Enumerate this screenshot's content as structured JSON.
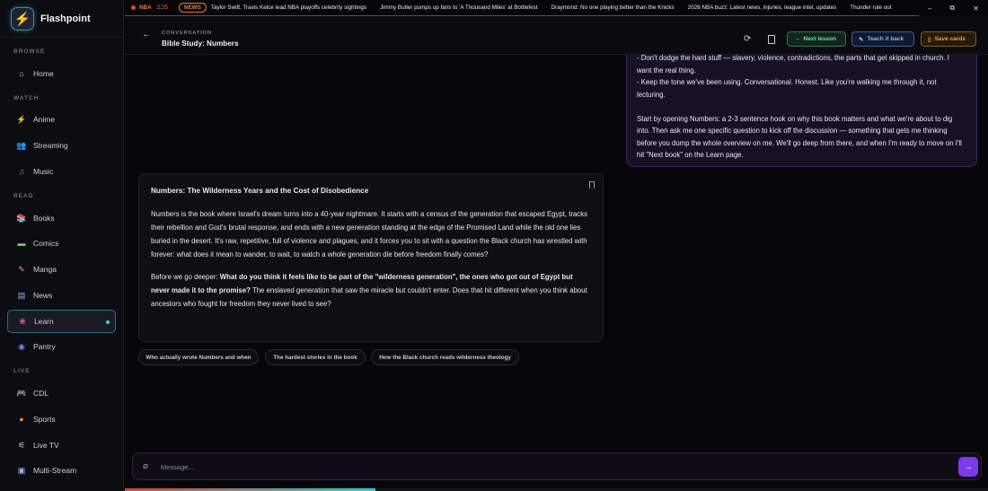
{
  "brand": {
    "name": "Flashpoint",
    "logo_icon": "⚡"
  },
  "sidebar": {
    "sections": [
      {
        "label": "BROWSE",
        "items": [
          {
            "label": "Home",
            "icon": "home-icon",
            "glyph": "⌂",
            "color": "#ccccd4"
          }
        ]
      },
      {
        "label": "WATCH",
        "items": [
          {
            "label": "Anime",
            "icon": "lightning-icon",
            "glyph": "⚡",
            "color": "#f07a2a"
          },
          {
            "label": "Streaming",
            "icon": "people-icon",
            "glyph": "👥",
            "color": "#a57af5"
          },
          {
            "label": "Music",
            "icon": "music-note-icon",
            "glyph": "♫",
            "color": "#e6508a"
          }
        ]
      },
      {
        "label": "READ",
        "items": [
          {
            "label": "Books",
            "icon": "books-icon",
            "glyph": "📚",
            "color": "#3cc46a"
          },
          {
            "label": "Comics",
            "icon": "comic-icon",
            "glyph": "▬",
            "color": "#63d44d"
          },
          {
            "label": "Manga",
            "icon": "manga-icon",
            "glyph": "✎",
            "color": "#e8a246"
          },
          {
            "label": "News",
            "icon": "newspaper-icon",
            "glyph": "▤",
            "color": "#8fb4ef"
          },
          {
            "label": "Learn",
            "icon": "brain-icon",
            "glyph": "❀",
            "color": "#e066b0",
            "active": true
          },
          {
            "label": "Pantry",
            "icon": "pantry-icon",
            "glyph": "◉",
            "color": "#8b7cf3"
          }
        ]
      },
      {
        "label": "LIVE",
        "items": [
          {
            "label": "CDL",
            "icon": "gamepad-icon",
            "glyph": "🎮",
            "color": "#a88cf2"
          },
          {
            "label": "Sports",
            "icon": "basketball-icon",
            "glyph": "●",
            "color": "#ef7d2c"
          },
          {
            "label": "Live TV",
            "icon": "antenna-icon",
            "glyph": "⚟",
            "color": "#d6d6de"
          },
          {
            "label": "Multi-Stream",
            "icon": "monitor-icon",
            "glyph": "▣",
            "color": "#9fb7e6"
          }
        ]
      }
    ]
  },
  "ticker": {
    "league": "NBA",
    "clock": "2:25",
    "news_badge": "NEWS",
    "headlines": [
      "Taylor Swift, Travis Kelce lead NBA playoffs celebrity sightings",
      "Jimmy Butler pumps up fans to 'A Thousand Miles' at Bottlefest",
      "Draymond: No one playing better than the Knicks",
      "2026 NBA buzz: Latest news, injuries, league intel, updates",
      "Thunder rule out"
    ]
  },
  "window_controls": {
    "minimize": "–",
    "maximize": "⧉",
    "close": "✕"
  },
  "header": {
    "label": "CONVERSATION",
    "title": "Bible Study: Numbers",
    "next": "Next lesson",
    "teach": "Teach it back",
    "save": "Save cards"
  },
  "chat": {
    "user": {
      "lines": [
        "- Don't dodge the hard stuff — slavery, violence, contradictions, the parts that get skipped in church. I want the real thing.",
        "- Keep the tone we've been using. Conversational. Honest. Like you're walking me through it, not lecturing."
      ],
      "closing": "Start by opening Numbers: a 2-3 sentence hook on why this book matters and what we're about to dig into. Then ask me one specific question to kick off the discussion — something that gets me thinking before you dump the whole overview on me. We'll go deep from there, and when I'm ready to move on I'll hit \"Next book\" on the Learn page."
    },
    "assistant": {
      "title": "Numbers: The Wilderness Years and the Cost of Disobedience",
      "p1": "Numbers is the book where Israel's dream turns into a 40-year nightmare. It starts with a census of the generation that escaped Egypt, tracks their rebellion and God's brutal response, and ends with a new generation standing at the edge of the Promised Land while the old one lies buried in the desert. It's raw, repetitive, full of violence and plagues, and it forces you to sit with a question the Black church has wrestled with forever: what does it mean to wander, to wait, to watch a whole generation die before freedom finally comes?",
      "p2_lead": "Before we go deeper: ",
      "p2_bold": "What do you think it feels like to be part of the \"wilderness generation\", the ones who got out of Egypt but never made it to the promise?",
      "p2_rest": " The enslaved generation that saw the miracle but couldn't enter. Does that hit different when you think about ancestors who fought for freedom they never lived to see?"
    },
    "suggestions": [
      "Who actually wrote Numbers and when",
      "The hardest stories in the book",
      "How the Black church reads wilderness theology"
    ]
  },
  "composer": {
    "placeholder": "Message..."
  },
  "progress": {
    "fraction": 0.29
  }
}
